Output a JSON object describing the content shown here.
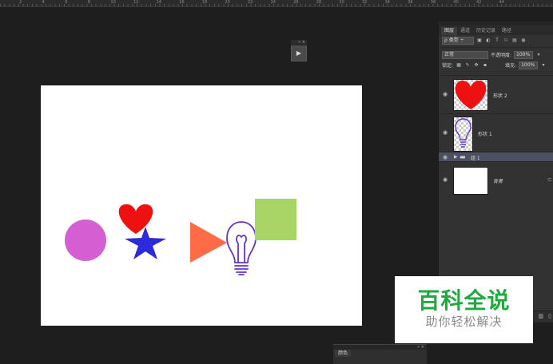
{
  "ruler": {
    "ticks": [
      "2",
      "4",
      "6",
      "8",
      "10",
      "12",
      "14",
      "16",
      "18",
      "20",
      "22",
      "24",
      "26",
      "28",
      "30",
      "32",
      "34",
      "36",
      "38",
      "40",
      "42",
      "44"
    ]
  },
  "mini_panel": {
    "header": "» ×",
    "play_icon": "▶"
  },
  "layers_panel": {
    "tabs": [
      "图层",
      "通道",
      "历史记录",
      "路径"
    ],
    "active_tab": 0,
    "filter_label": "ρ 类型",
    "blend_mode": "正常",
    "opacity_label": "不透明度:",
    "opacity_value": "100%",
    "lock_label": "锁定:",
    "fill_label": "填充:",
    "fill_value": "100%",
    "layers": [
      {
        "name": "形状 2",
        "type": "shape-heart"
      },
      {
        "name": "形状 1",
        "type": "shape-bulb"
      },
      {
        "name": "组 1",
        "type": "group"
      },
      {
        "name": "背景",
        "type": "background"
      }
    ]
  },
  "bottom_panel": {
    "header": "» ×",
    "tab": "颜色"
  },
  "watermark": {
    "title": "百科全说",
    "subtitle": "助你轻松解决"
  },
  "colors": {
    "circle": "#d35fd3",
    "heart": "#ee1111",
    "star": "#2b2bdd",
    "triangle": "#ff6a47",
    "bulb": "#6633cc",
    "square": "#a6d465",
    "watermark_green": "#1faa3f"
  }
}
